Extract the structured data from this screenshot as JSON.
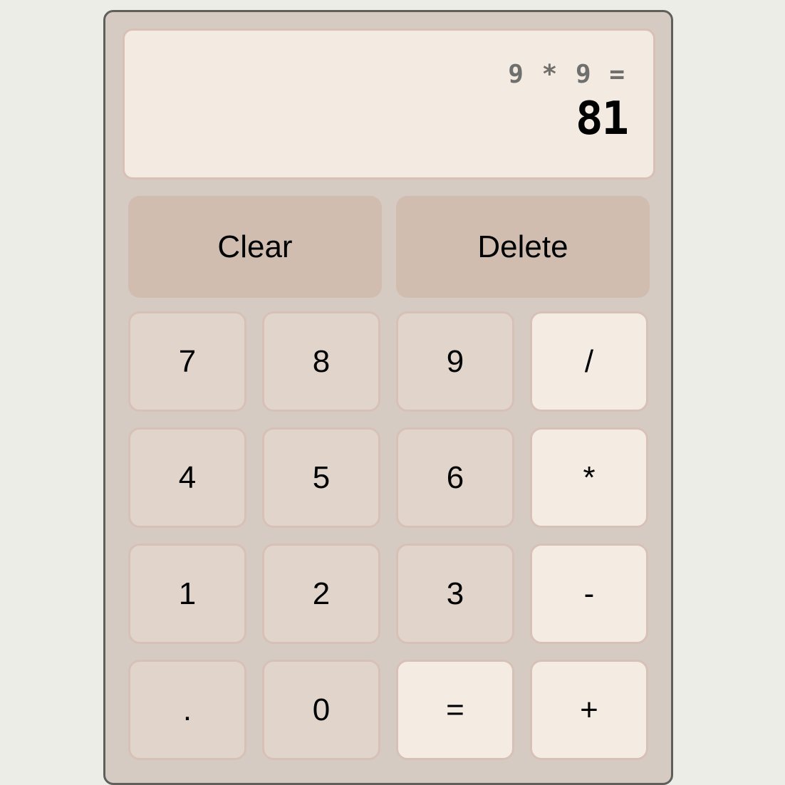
{
  "display": {
    "expression": "9 * 9 =",
    "result": "81"
  },
  "controls": {
    "clear": "Clear",
    "delete": "Delete"
  },
  "keys": {
    "k7": "7",
    "k8": "8",
    "k9": "9",
    "divide": "/",
    "k4": "4",
    "k5": "5",
    "k6": "6",
    "multiply": "*",
    "k1": "1",
    "k2": "2",
    "k3": "3",
    "subtract": "-",
    "decimal": ".",
    "k0": "0",
    "equals": "=",
    "add": "+"
  },
  "colors": {
    "page_background": "#edede8",
    "calculator_body": "#d6cbc2",
    "display_background": "#f3eae2",
    "control_button": "#d1bcb0",
    "number_button": "#e1d4cb",
    "operator_button": "#f4ebe3"
  }
}
